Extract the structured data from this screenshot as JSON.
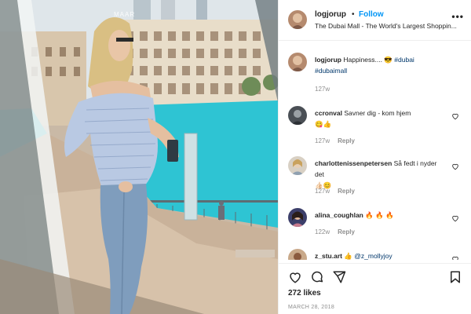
{
  "post": {
    "username": "logjorup",
    "follow_label": "Follow",
    "dot": "•",
    "location": "The Dubai Mall - The World's Largest Shoppin...",
    "more_label": "•••",
    "caption_user": "logjorup",
    "caption_text": " Happiness.... 😎 ",
    "caption_tag1": "#dubai",
    "caption_tag2": "#dubaimall",
    "caption_time": "127w",
    "watermark": "MAAR"
  },
  "comments": [
    {
      "user": "ccronval",
      "text": " Savner dig - kom hjem ",
      "emoji": "😋👍",
      "time": "127w",
      "reply": "Reply"
    },
    {
      "user": "charlottenissenpetersen",
      "text": " Så fedt i nyder det",
      "emoji": "👍🏻😊",
      "time": "127w",
      "reply": "Reply"
    },
    {
      "user": "alina_coughlan",
      "text": " ",
      "emoji": "🔥 🔥 🔥",
      "time": "122w",
      "reply": "Reply"
    },
    {
      "user": "z_stu.art",
      "text": " 👍 ",
      "tag": "@z_mollyjoy",
      "time": "",
      "reply": ""
    }
  ],
  "footer": {
    "likes": "272 likes",
    "date": "MARCH 28, 2018"
  },
  "icons": {
    "like": "heart-icon",
    "comment": "comment-icon",
    "share": "share-icon",
    "save": "bookmark-icon",
    "more": "more-icon"
  },
  "colors": {
    "follow": "#0095f6",
    "link": "#00376b",
    "muted": "#8e8e8e",
    "water": "#2ec4d3"
  }
}
